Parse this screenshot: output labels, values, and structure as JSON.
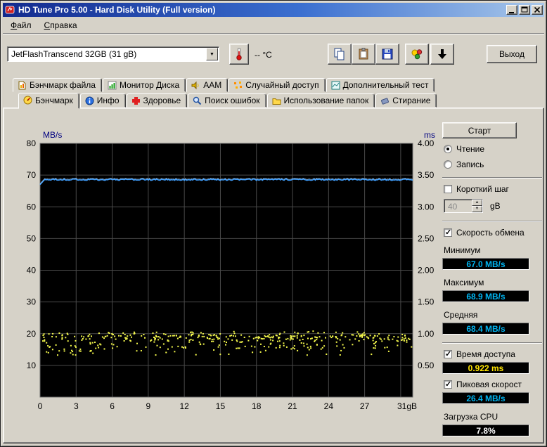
{
  "window": {
    "title": "HD Tune Pro 5.00 - Hard Disk Utility (Full  version)"
  },
  "menu": {
    "file": "Файл",
    "help": "Справка"
  },
  "toolbar": {
    "drive_select": "JetFlashTranscend 32GB  (31 gB)",
    "temperature": "-- °C",
    "exit_label": "Выход",
    "combo_arrow": "▼"
  },
  "tabs": {
    "row1": [
      "Бэнчмарк файла",
      "Монитор Диска",
      "AAM",
      "Случайный доступ",
      "Дополнительный тест"
    ],
    "row2": [
      "Бэнчмарк",
      "Инфо",
      "Здоровье",
      "Поиск ошибок",
      "Использование папок",
      "Стирание"
    ],
    "active": "Бэнчмарк"
  },
  "panel": {
    "start_label": "Старт",
    "read_label": "Чтение",
    "read_selected": true,
    "write_label": "Запись",
    "write_selected": false,
    "short_stride_label": "Короткий шаг",
    "short_stride_checked": false,
    "stride_value": "40",
    "stride_unit": "gB",
    "transfer_label": "Скорость обмена",
    "transfer_checked": true,
    "min_label": "Минимум",
    "min_value": "67.0 MB/s",
    "max_label": "Максимум",
    "max_value": "68.9 MB/s",
    "avg_label": "Средняя",
    "avg_value": "68.4 MB/s",
    "access_label": "Время доступа",
    "access_checked": true,
    "access_value": "0.922 ms",
    "burst_label": "Пиковая скорост",
    "burst_checked": true,
    "burst_value": "26.4 MB/s",
    "cpu_label": "Загрузка CPU",
    "cpu_value": "7.8%"
  },
  "theme": {
    "speed_value_color": "#00b4f0",
    "access_value_color": "#ffe400",
    "cpu_value_color": "#ffffff",
    "titlebar_start": "#122a8e",
    "titlebar_end": "#a9c8ea",
    "chrome_gray": "#d6d2c8"
  },
  "chart_data": {
    "type": "line",
    "title": "",
    "left_axis": {
      "label": "MB/s",
      "min": 0,
      "max": 80,
      "ticks": [
        10,
        20,
        30,
        40,
        50,
        60,
        70,
        80
      ]
    },
    "right_axis": {
      "label": "ms",
      "min": 0,
      "max": 4.0,
      "tick_values": [
        0.5,
        1.0,
        1.5,
        2.0,
        2.5,
        3.0,
        3.5,
        4.0
      ],
      "tick_labels": [
        "0.50",
        "1.00",
        "1.50",
        "2.00",
        "2.50",
        "3.00",
        "3.50",
        "4.00"
      ]
    },
    "x_axis": {
      "label": "",
      "min": 0,
      "max": 31,
      "tick_values": [
        0,
        3,
        6,
        9,
        12,
        15,
        18,
        21,
        24,
        27,
        31
      ],
      "tick_labels": [
        "0",
        "3",
        "6",
        "9",
        "12",
        "15",
        "18",
        "21",
        "24",
        "27",
        "31gB"
      ]
    },
    "plot_bg": "#000000",
    "grid_color": "#4a4a4a",
    "grid": true,
    "series": [
      {
        "name": "transfer-rate",
        "type": "line",
        "color": "#3f9fff",
        "unit": "MB/s",
        "min": 67.0,
        "max": 68.9,
        "avg": 68.4
      },
      {
        "name": "access-time",
        "type": "scatter",
        "color": "#f4f84c",
        "unit": "ms",
        "avg": 0.922,
        "band_ms": [
          0.62,
          1.05
        ],
        "points": 430
      }
    ]
  }
}
